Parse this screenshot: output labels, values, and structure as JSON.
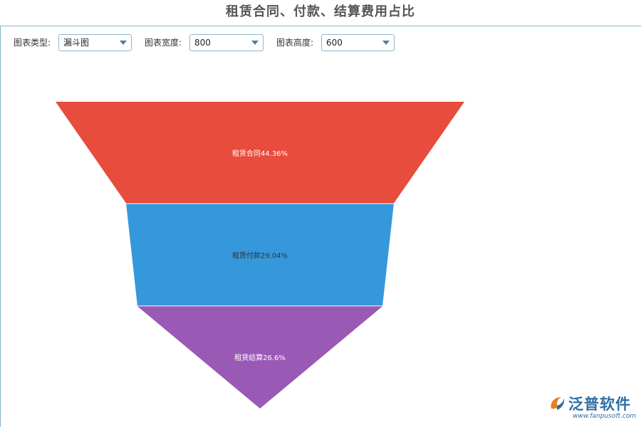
{
  "title": "租赁合同、付款、结算费用占比",
  "controls": {
    "type_label": "图表类型:",
    "type_value": "漏斗图",
    "width_label": "图表宽度:",
    "width_value": "800",
    "height_label": "图表高度:",
    "height_value": "600"
  },
  "chart_data": {
    "type": "funnel",
    "title": "租赁合同、付款、结算费用占比",
    "series": [
      {
        "label": "租赁合同44.36%",
        "name": "租赁合同",
        "value": 44.36,
        "color": "#e74c3c",
        "text_color": "#ffffff"
      },
      {
        "label": "租赁付款29.04%",
        "name": "租赁付款",
        "value": 29.04,
        "color": "#3498db",
        "text_color": "#333333"
      },
      {
        "label": "租赁结算26.6%",
        "name": "租赁结算",
        "value": 26.6,
        "color": "#9b59b6",
        "text_color": "#ffffff"
      }
    ]
  },
  "logo": {
    "text": "泛普软件",
    "url": "www.fanpusoft.com",
    "color": "#2f6da5"
  }
}
